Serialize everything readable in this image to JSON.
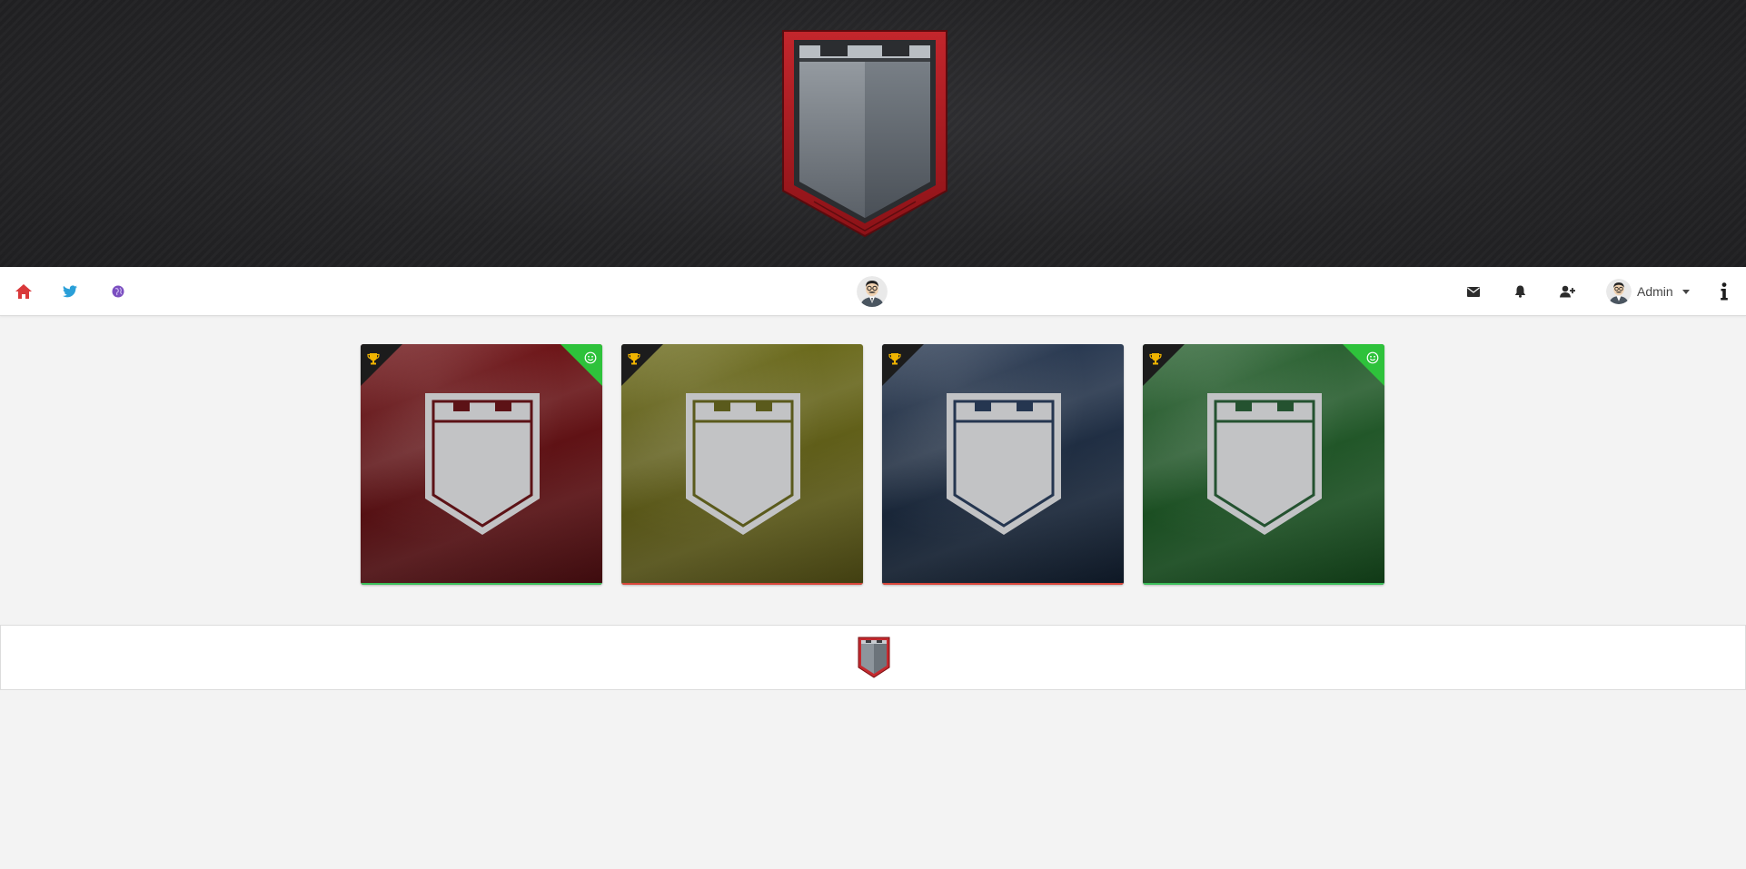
{
  "header": {
    "logo_icon": "castle-shield-logo"
  },
  "navbar": {
    "left_icons": [
      {
        "name": "home-icon",
        "color": "#d9383a"
      },
      {
        "name": "twitter-icon",
        "color": "#2a9fd8"
      },
      {
        "name": "globe-icon",
        "color": "#7b4fc0"
      }
    ],
    "center_avatar": "user-avatar",
    "right_icons": [
      {
        "name": "envelope-icon"
      },
      {
        "name": "bell-icon"
      },
      {
        "name": "add-user-icon"
      }
    ],
    "user": {
      "name": "Admin"
    },
    "info_icon": "info-icon"
  },
  "teams": [
    {
      "color": "red",
      "base": "#6e1518",
      "accent": "#4a0d10",
      "shield_trim": "#5c1216",
      "trophy": true,
      "smile": true,
      "bar_color": "#3bbf5a"
    },
    {
      "color": "yellow",
      "base": "#6b6a1c",
      "accent": "#4f4c14",
      "shield_trim": "#5a5a1c",
      "trophy": true,
      "smile": false,
      "bar_color": "#d9463a"
    },
    {
      "color": "blue",
      "base": "#2a3a52",
      "accent": "#101c2c",
      "shield_trim": "#253650",
      "trophy": true,
      "smile": false,
      "bar_color": "#d9463a"
    },
    {
      "color": "green",
      "base": "#2b6232",
      "accent": "#13451a",
      "shield_trim": "#245230",
      "trophy": true,
      "smile": true,
      "bar_color": "#3bbf5a"
    }
  ],
  "footer": {
    "logo_icon": "small-castle-shield-logo"
  },
  "colors": {
    "background": "#f3f3f3",
    "banner": "#242426",
    "trophy": "#f0b400",
    "success": "#2ec23b"
  }
}
